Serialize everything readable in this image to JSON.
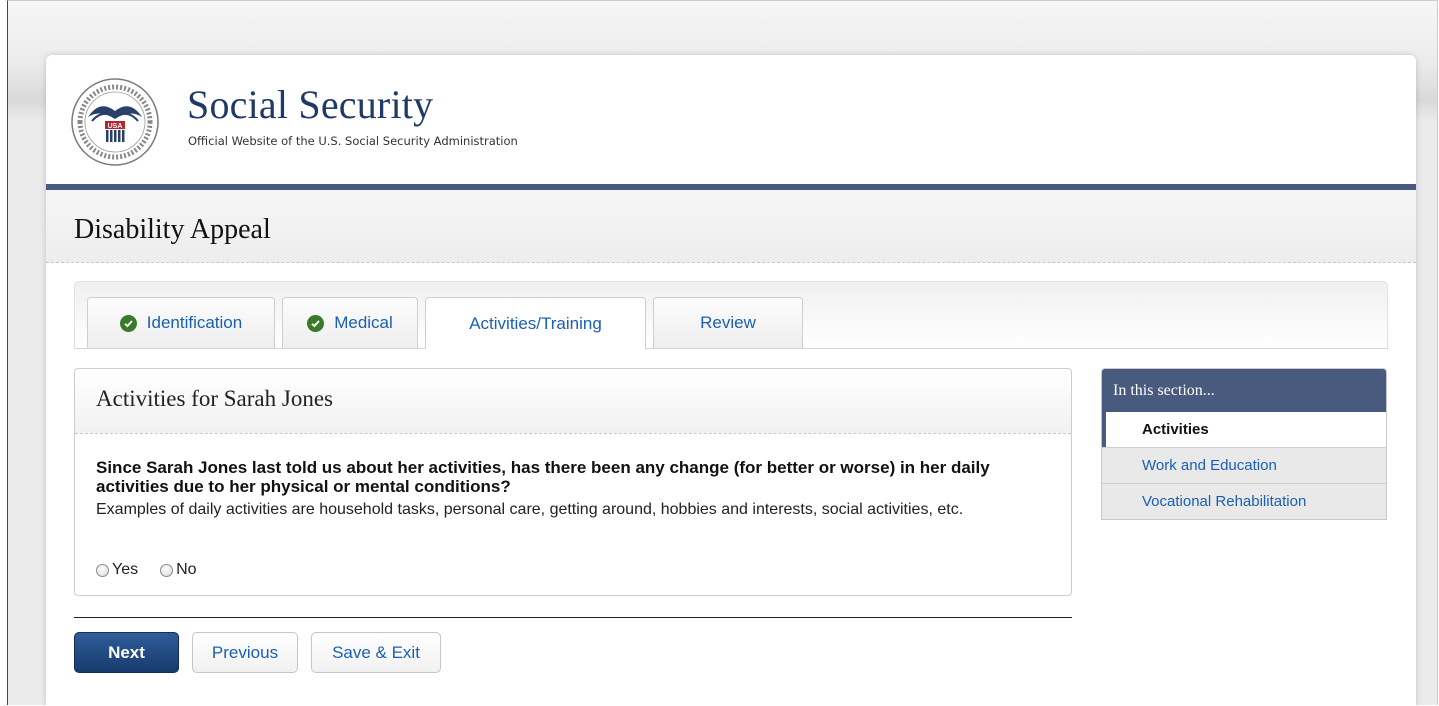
{
  "brand": {
    "title": "Social Security",
    "subtitle": "Official Website of the U.S. Social Security Administration",
    "seal_text": "USA"
  },
  "page_title": "Disability Appeal",
  "tabs": [
    {
      "label": "Identification",
      "completed": true,
      "active": false
    },
    {
      "label": "Medical",
      "completed": true,
      "active": false
    },
    {
      "label": "Activities/Training",
      "completed": false,
      "active": true
    },
    {
      "label": "Review",
      "completed": false,
      "active": false
    }
  ],
  "section": {
    "title": "Activities for Sarah Jones",
    "question": "Since Sarah Jones last told us about her activities, has there been any change (for better or worse) in her daily activities due to her physical or mental conditions?",
    "examples": "Examples of daily activities are household tasks, personal care, getting around, hobbies and interests, social activities, etc.",
    "options": [
      "Yes",
      "No"
    ]
  },
  "buttons": {
    "next": "Next",
    "previous": "Previous",
    "save_exit": "Save & Exit"
  },
  "side_nav": {
    "heading": "In this section...",
    "items": [
      {
        "label": "Activities",
        "active": true
      },
      {
        "label": "Work and Education",
        "active": false
      },
      {
        "label": "Vocational Rehabilitation",
        "active": false
      }
    ]
  },
  "colors": {
    "brand_navy": "#485a7e",
    "link_blue": "#1a5fb4",
    "check_green": "#3a7a2a"
  }
}
